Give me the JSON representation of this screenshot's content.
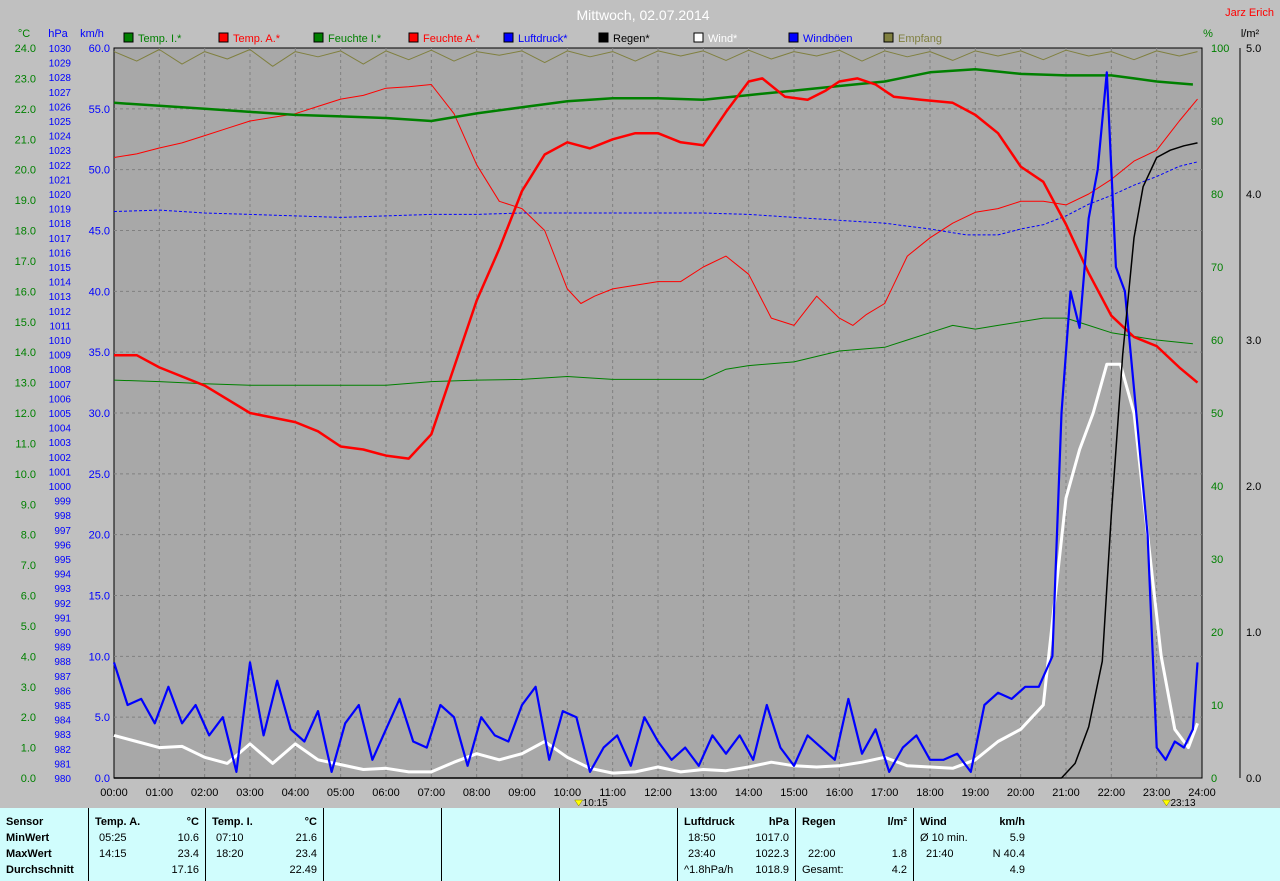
{
  "chart_data": {
    "type": "line",
    "title": "Mittwoch, 02.07.2014",
    "author": "Jarz Erich",
    "axis_units": {
      "temp": "°C",
      "pressure": "hPa",
      "wind": "km/h",
      "humidity": "%",
      "rain": "l/m²"
    },
    "x_ticks": [
      "00:00",
      "01:00",
      "02:00",
      "03:00",
      "04:00",
      "05:00",
      "06:00",
      "07:00",
      "08:00",
      "09:00",
      "10:00",
      "11:00",
      "12:00",
      "13:00",
      "14:00",
      "15:00",
      "16:00",
      "17:00",
      "18:00",
      "19:00",
      "20:00",
      "21:00",
      "22:00",
      "23:00",
      "24:00"
    ],
    "markers": [
      "10:15",
      "23:13"
    ],
    "temp_axis": {
      "min": 0,
      "max": 24,
      "step": 1
    },
    "pressure_axis": {
      "min": 980,
      "max": 1030,
      "step": 1
    },
    "wind_axis": {
      "min": 0,
      "max": 60,
      "step": 5
    },
    "humidity_axis": {
      "min": 0,
      "max": 100,
      "ticks": [
        0,
        10,
        20,
        30,
        40,
        50,
        60,
        70,
        80,
        90,
        100
      ]
    },
    "rain_axis": {
      "min": 0,
      "max": 5,
      "ticks": [
        "0.0",
        "1.0",
        "2.0",
        "3.0",
        "4.0",
        "5.0"
      ]
    },
    "grid": true,
    "legend": [
      "Temp. I.*",
      "Temp. A.*",
      "Feuchte I.*",
      "Feuchte A.*",
      "Luftdruck*",
      "Regen*",
      "Wind*",
      "Windböen",
      "Empfang"
    ],
    "series": [
      {
        "name": "Temp. I.*",
        "color": "#008000",
        "axis": "temp",
        "x": [
          0,
          1,
          2,
          3,
          4,
          5,
          6,
          7,
          8,
          9,
          10,
          11,
          12,
          13,
          14,
          15,
          16,
          17,
          18,
          19,
          20,
          21,
          21.5,
          22,
          22.5,
          23,
          23.8
        ],
        "y": [
          22.2,
          22.1,
          22.0,
          21.9,
          21.8,
          21.75,
          21.7,
          21.6,
          21.85,
          22.05,
          22.25,
          22.35,
          22.35,
          22.3,
          22.45,
          22.6,
          22.75,
          22.9,
          23.2,
          23.3,
          23.15,
          23.1,
          23.1,
          23.1,
          23.0,
          22.9,
          22.8
        ]
      },
      {
        "name": "Temp. A.*",
        "color": "#ff0000",
        "axis": "temp",
        "x": [
          0,
          0.5,
          1,
          2,
          3,
          4,
          4.5,
          5,
          5.5,
          6,
          6.5,
          7,
          7.5,
          8,
          8.5,
          9,
          9.5,
          10,
          10.5,
          11,
          11.5,
          12,
          12.5,
          13,
          13.5,
          14,
          14.3,
          14.8,
          15.3,
          15.7,
          16,
          16.4,
          16.8,
          17.2,
          17.8,
          18.5,
          19,
          19.5,
          20,
          20.5,
          21,
          21.5,
          22,
          22.5,
          23,
          23.5,
          23.9
        ],
        "y": [
          13.9,
          13.9,
          13.5,
          12.9,
          12.0,
          11.7,
          11.4,
          10.9,
          10.8,
          10.6,
          10.5,
          11.3,
          13.5,
          15.7,
          17.4,
          19.3,
          20.5,
          20.9,
          20.7,
          21.0,
          21.2,
          21.2,
          20.9,
          20.8,
          21.9,
          22.9,
          23.0,
          22.4,
          22.3,
          22.6,
          22.9,
          23.0,
          22.8,
          22.4,
          22.3,
          22.2,
          21.8,
          21.2,
          20.1,
          19.6,
          18.2,
          16.6,
          15.2,
          14.5,
          14.2,
          13.5,
          13.0
        ]
      },
      {
        "name": "Feuchte I.*",
        "color": "#008000",
        "axis": "humidity",
        "x": [
          0,
          1,
          2,
          3,
          4,
          5,
          6,
          7,
          8,
          9,
          10,
          11,
          12,
          13,
          13.5,
          14,
          15,
          16,
          17,
          17.5,
          18,
          18.5,
          19,
          19.5,
          20,
          20.5,
          21,
          21.5,
          22,
          22.5,
          23,
          23.8
        ],
        "y": [
          54.5,
          54.3,
          54,
          53.8,
          53.8,
          53.8,
          53.8,
          54.3,
          54.5,
          54.6,
          55,
          54.6,
          54.6,
          54.6,
          56,
          56.5,
          57,
          58.5,
          59,
          60,
          61,
          62,
          61.5,
          62,
          62.5,
          63,
          63,
          62,
          61,
          60.5,
          60,
          59.5
        ]
      },
      {
        "name": "Feuchte A.*",
        "color": "#ff0000",
        "axis": "humidity",
        "x": [
          0,
          0.5,
          1,
          1.5,
          2,
          2.5,
          3,
          3.5,
          4,
          4.5,
          5,
          5.5,
          6,
          6.5,
          7,
          7.5,
          8,
          8.5,
          9,
          9.5,
          10,
          10.3,
          10.6,
          11,
          11.5,
          12,
          12.5,
          13,
          13.5,
          14,
          14.5,
          15,
          15.5,
          16,
          16.3,
          16.6,
          17,
          17.5,
          18,
          18.5,
          19,
          19.5,
          20,
          20.5,
          21,
          21.5,
          22,
          22.5,
          23,
          23.5,
          23.9
        ],
        "y": [
          85.0,
          85.5,
          86.3,
          87.0,
          88.0,
          89.0,
          90.0,
          90.5,
          91.0,
          92.0,
          93.0,
          93.5,
          94.5,
          94.7,
          95.0,
          91.0,
          84.0,
          79.0,
          78.0,
          75.0,
          67.0,
          65.0,
          66.0,
          67.0,
          67.5,
          68.0,
          68.0,
          70.0,
          71.5,
          69.0,
          63.0,
          62.0,
          66.0,
          63.0,
          62.0,
          63.5,
          65.0,
          71.5,
          74.0,
          76.0,
          77.5,
          78.0,
          79.0,
          79.0,
          78.5,
          80.0,
          82.0,
          84.5,
          86.0,
          90.0,
          93.0
        ]
      },
      {
        "name": "Luftdruck*",
        "color": "#0000ff",
        "axis": "pressure",
        "x": [
          0,
          1,
          2,
          3,
          4,
          5,
          6,
          7,
          8,
          9,
          10,
          11,
          12,
          13,
          14,
          15,
          16,
          17,
          18,
          18.8,
          19.5,
          20,
          20.5,
          21,
          21.5,
          22,
          22.5,
          23,
          23.5,
          23.9
        ],
        "y": [
          1018.8,
          1018.9,
          1018.7,
          1018.6,
          1018.5,
          1018.4,
          1018.5,
          1018.6,
          1018.6,
          1018.7,
          1018.7,
          1018.7,
          1018.7,
          1018.7,
          1018.6,
          1018.4,
          1018.2,
          1018.0,
          1017.6,
          1017.2,
          1017.2,
          1017.6,
          1017.9,
          1018.5,
          1019.3,
          1019.9,
          1020.6,
          1021.2,
          1021.9,
          1022.2
        ]
      },
      {
        "name": "Regen*",
        "color": "#000000",
        "axis": "rain",
        "x": [
          0,
          20.9,
          21.2,
          21.5,
          21.8,
          22.0,
          22.25,
          22.5,
          22.7,
          23.0,
          23.3,
          23.6,
          23.9
        ],
        "y": [
          0,
          0,
          0.1,
          0.35,
          0.8,
          1.8,
          2.9,
          3.7,
          4.05,
          4.25,
          4.3,
          4.33,
          4.35
        ]
      },
      {
        "name": "Wind*",
        "color": "#ffffff",
        "axis": "wind",
        "x": [
          0,
          0.5,
          1,
          1.5,
          2,
          2.5,
          3,
          3.5,
          4,
          4.5,
          5,
          5.5,
          6,
          6.5,
          7,
          7.5,
          8,
          8.5,
          9,
          9.5,
          10,
          10.5,
          11,
          11.5,
          12,
          12.5,
          13,
          13.5,
          14,
          14.5,
          15,
          15.5,
          16,
          16.5,
          17,
          17.5,
          18,
          18.5,
          19,
          19.5,
          20,
          20.5,
          21,
          21.3,
          21.6,
          21.9,
          22.2,
          22.5,
          22.8,
          23.1,
          23.4,
          23.7,
          23.9
        ],
        "y": [
          3.5,
          3.0,
          2.5,
          2.6,
          1.7,
          1.2,
          2.8,
          1.2,
          2.8,
          1.5,
          1.1,
          0.7,
          0.8,
          0.5,
          0.5,
          1.3,
          2.0,
          1.5,
          2.0,
          3.0,
          1.7,
          0.8,
          0.4,
          0.5,
          0.9,
          0.5,
          0.7,
          0.6,
          0.9,
          1.3,
          1.0,
          0.9,
          1.0,
          1.3,
          1.7,
          1.0,
          0.9,
          0.8,
          1.5,
          3.0,
          4.0,
          6.0,
          23.0,
          27.0,
          30.0,
          34.0,
          34.0,
          30.0,
          20.0,
          10.0,
          4.0,
          2.5,
          4.5
        ]
      },
      {
        "name": "Windböen",
        "color": "#0000ff",
        "axis": "wind",
        "x": [
          0,
          0.3,
          0.6,
          0.9,
          1.2,
          1.5,
          1.8,
          2.1,
          2.4,
          2.7,
          3.0,
          3.3,
          3.6,
          3.9,
          4.2,
          4.5,
          4.8,
          5.1,
          5.4,
          5.7,
          6.0,
          6.3,
          6.6,
          6.9,
          7.2,
          7.5,
          7.8,
          8.1,
          8.4,
          8.7,
          9.0,
          9.3,
          9.6,
          9.9,
          10.2,
          10.5,
          10.8,
          11.1,
          11.4,
          11.7,
          12.0,
          12.3,
          12.6,
          12.9,
          13.2,
          13.5,
          13.8,
          14.1,
          14.4,
          14.7,
          15.0,
          15.3,
          15.6,
          15.9,
          16.2,
          16.5,
          16.8,
          17.1,
          17.4,
          17.7,
          18.0,
          18.3,
          18.6,
          18.9,
          19.2,
          19.5,
          19.8,
          20.1,
          20.4,
          20.7,
          20.9,
          21.1,
          21.3,
          21.5,
          21.7,
          21.9,
          22.1,
          22.3,
          22.5,
          22.8,
          23.0,
          23.2,
          23.4,
          23.6,
          23.8,
          23.9
        ],
        "y": [
          9.5,
          6.0,
          6.5,
          4.5,
          7.5,
          4.5,
          6.0,
          3.5,
          5.0,
          0.5,
          9.5,
          3.5,
          8.0,
          4.0,
          3.0,
          5.5,
          0.5,
          4.5,
          6.0,
          1.5,
          4.0,
          6.5,
          3.0,
          2.5,
          6.0,
          5.0,
          1.0,
          5.0,
          3.5,
          3.0,
          6.0,
          7.5,
          1.5,
          5.5,
          5.0,
          0.5,
          2.5,
          3.5,
          1.0,
          5.0,
          3.0,
          1.5,
          2.5,
          1.0,
          3.5,
          2.0,
          3.5,
          1.5,
          6.0,
          2.5,
          1.0,
          3.5,
          2.5,
          1.5,
          6.5,
          2.0,
          4.0,
          0.5,
          2.5,
          3.5,
          1.5,
          1.5,
          2.0,
          0.5,
          6.0,
          7.0,
          6.5,
          7.5,
          7.5,
          10.0,
          30.0,
          40.0,
          37.0,
          46.0,
          50.0,
          58.0,
          42.0,
          40.0,
          32.0,
          20.0,
          2.5,
          1.5,
          3.0,
          2.5,
          4.0,
          9.5
        ]
      },
      {
        "name": "Empfang",
        "color": "#808040",
        "axis": "humidity",
        "x": [
          0,
          0.5,
          1,
          1.5,
          2,
          2.5,
          3,
          3.5,
          4,
          4.5,
          5,
          5.5,
          6,
          6.5,
          7,
          7.5,
          8,
          8.5,
          9,
          9.5,
          10,
          10.5,
          11,
          11.5,
          12,
          12.5,
          13,
          13.5,
          14,
          14.5,
          15,
          15.5,
          16,
          16.5,
          17,
          17.5,
          18,
          18.5,
          19,
          19.5,
          20,
          20.5,
          21,
          21.5,
          22,
          22.5,
          23,
          23.5,
          23.9
        ],
        "y": [
          99.5,
          98.2,
          99.8,
          97.8,
          99.5,
          98.5,
          99.8,
          97.5,
          99.5,
          98.8,
          99.6,
          97.8,
          99.6,
          98.4,
          99.7,
          98.2,
          99.5,
          99.0,
          99.6,
          98.0,
          99.6,
          98.8,
          99.5,
          98.2,
          99.6,
          98.9,
          99.6,
          98.3,
          99.7,
          98.5,
          99.5,
          98.9,
          99.7,
          98.2,
          99.6,
          98.8,
          99.5,
          98.3,
          99.6,
          98.9,
          99.6,
          98.4,
          99.7,
          98.9,
          99.5,
          98.4,
          99.6,
          98.9,
          99.5
        ]
      }
    ]
  },
  "stats_panel": {
    "row_labels": [
      "Sensor",
      "MinWert",
      "MaxWert",
      "Durchschnitt"
    ],
    "temp_a": {
      "header": "Temp. A.",
      "unit": "°C",
      "min_time": "05:25",
      "min_val": "10.6",
      "max_time": "14:15",
      "max_val": "23.4",
      "avg": "17.16"
    },
    "temp_i": {
      "header": "Temp. I.",
      "unit": "°C",
      "min_time": "07:10",
      "min_val": "21.6",
      "max_time": "18:20",
      "max_val": "23.4",
      "avg": "22.49"
    },
    "pressure": {
      "header": "Luftdruck",
      "unit": "hPa",
      "min_time": "18:50",
      "min_val": "1017.0",
      "max_time": "23:40",
      "max_val": "1022.3",
      "trend": "^1.8hPa/h",
      "avg": "1018.9"
    },
    "rain": {
      "header": "Regen",
      "unit": "l/m²",
      "time": "22:00",
      "max_val": "1.8",
      "total_label": "Gesamt:",
      "total": "4.2"
    },
    "wind": {
      "header": "Wind",
      "unit": "km/h",
      "avg10_label": "Ø 10 min.",
      "avg10": "5.9",
      "max_time": "21:40",
      "max_val": "N 40.4",
      "avg": "4.9"
    }
  }
}
